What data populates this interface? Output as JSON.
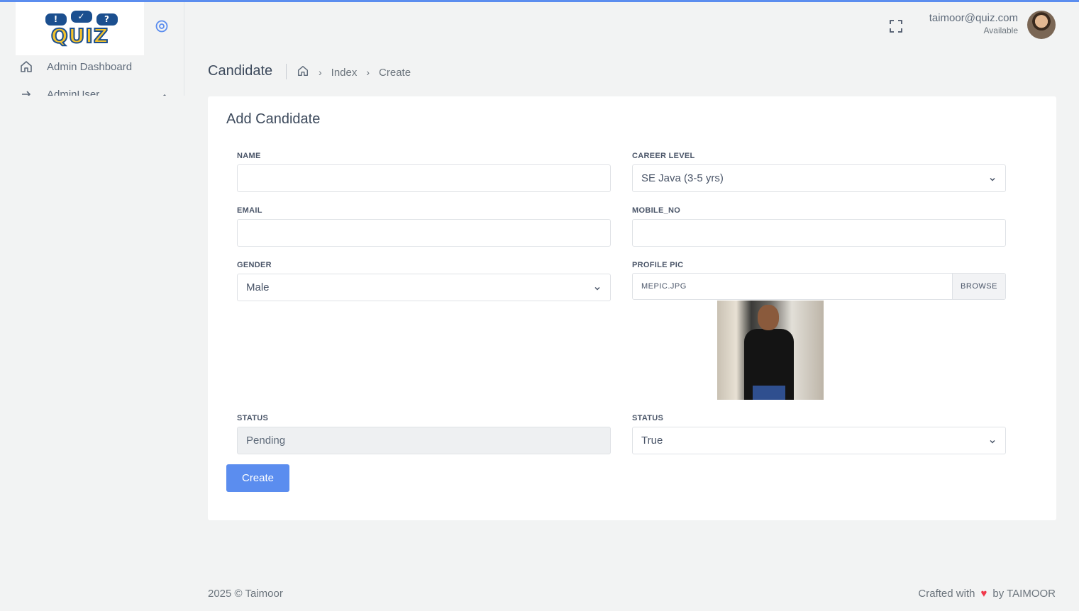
{
  "colors": {
    "accent": "#5b8def",
    "heart": "#f0384a",
    "background": "#f2f3f3",
    "card": "#ffffff"
  },
  "logo": {
    "word": "QUIZ",
    "bubbles": [
      "!",
      "✓",
      "?"
    ]
  },
  "sidebar": {
    "items": [
      {
        "label": "Admin Dashboard",
        "icon": "home-icon"
      },
      {
        "label": "AdminUser",
        "icon": "arrow-right-icon",
        "expanded": true
      }
    ]
  },
  "header": {
    "user_email": "taimoor@quiz.com",
    "user_status": "Available"
  },
  "page": {
    "title": "Candidate",
    "breadcrumb": [
      "Index",
      "Create"
    ]
  },
  "form": {
    "title": "Add Candidate",
    "name": {
      "label": "NAME",
      "value": ""
    },
    "career_level": {
      "label": "CAREER LEVEL",
      "value": "SE Java (3-5 yrs)"
    },
    "email": {
      "label": "EMAIL",
      "value": ""
    },
    "mobile": {
      "label": "MOBILE_NO",
      "value": ""
    },
    "gender": {
      "label": "GENDER",
      "value": "Male"
    },
    "profile_pic": {
      "label": "PROFILE PIC",
      "file": "MEPIC.JPG",
      "browse": "BROWSE"
    },
    "status_text": {
      "label": "STATUS",
      "value": "Pending"
    },
    "status_select": {
      "label": "STATUS",
      "value": "True"
    },
    "submit": "Create"
  },
  "footer": {
    "left": "2025 © Taimoor",
    "crafted": "Crafted with",
    "by": "by TAIMOOR"
  }
}
